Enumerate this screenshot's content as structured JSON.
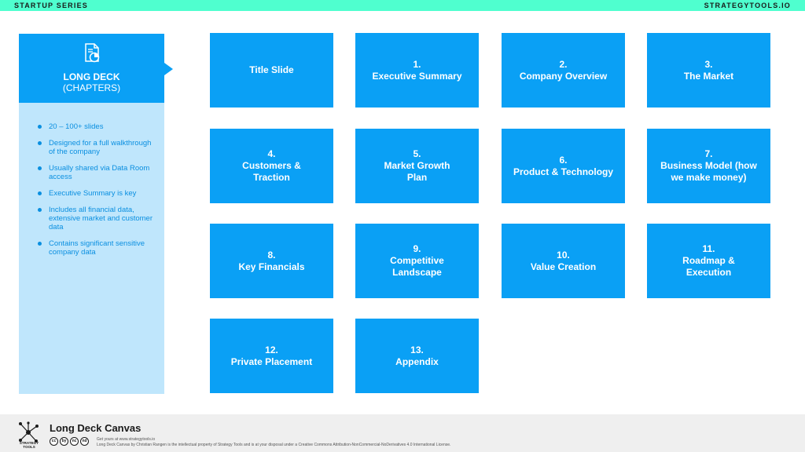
{
  "header": {
    "series": "STARTUP SERIES",
    "brand": "STRATEGYTOOLS.IO"
  },
  "sidebar": {
    "icon": "document-chart-icon",
    "title": "LONG DECK",
    "subtitle": "(CHAPTERS)",
    "bullets": [
      "20 – 100+ slides",
      "Designed for a full walkthrough of the company",
      "Usually shared via Data Room access",
      "Executive Summary is key",
      "Includes all financial data, extensive market and customer data",
      "Contains significant sensitive company data"
    ]
  },
  "tiles": [
    {
      "number": "",
      "label": "Title Slide"
    },
    {
      "number": "1.",
      "label": "Executive Summary"
    },
    {
      "number": "2.",
      "label": "Company Overview"
    },
    {
      "number": "3.",
      "label": "The Market"
    },
    {
      "number": "4.",
      "label": "Customers & Traction"
    },
    {
      "number": "5.",
      "label": "Market Growth Plan"
    },
    {
      "number": "6.",
      "label": "Product & Technology"
    },
    {
      "number": "7.",
      "label": "Business Model (how we make money)"
    },
    {
      "number": "8.",
      "label": "Key Financials"
    },
    {
      "number": "9.",
      "label": "Competitive Landscape"
    },
    {
      "number": "10.",
      "label": "Value Creation"
    },
    {
      "number": "11.",
      "label": "Roadmap & Execution"
    },
    {
      "number": "12.",
      "label": "Private Placement"
    },
    {
      "number": "13.",
      "label": "Appendix"
    }
  ],
  "footer": {
    "logo_icon": "strategy-tools-network-icon",
    "logo_text": "STRATEGY TOOLS",
    "title": "Long Deck Canvas",
    "get_yours": "Get yours at www.strategytools.io",
    "license": "Long Deck Canvas by Christian Rangen is the intellectual property of Strategy Tools and is at your disposal under a Creative Commons Attribution-NonCommercial-NoDerivatives 4.0 International License.",
    "cc_icons": [
      "cc",
      "by",
      "nc",
      "nd"
    ]
  },
  "colors": {
    "accent": "#0aa0f5",
    "light_panel": "#bfe6fc",
    "top_bar": "#4fffcf",
    "footer_bg": "#efefef"
  }
}
